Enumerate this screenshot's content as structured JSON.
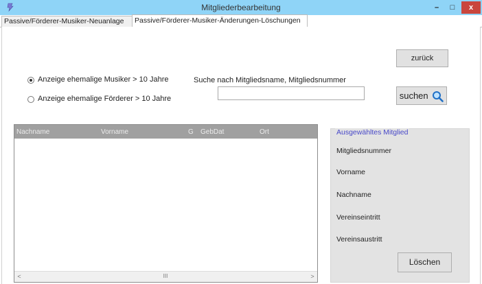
{
  "window": {
    "title": "Mitgliederbearbeitung",
    "minimize": "–",
    "maximize": "□",
    "close": "x"
  },
  "tabs": [
    {
      "label": "Passive/Förderer-Musiker-Neuanlage",
      "active": false
    },
    {
      "label": "Passive/Förderer-Musiker-Änderungen-Löschungen",
      "active": true
    }
  ],
  "buttons": {
    "back": "zurück",
    "search": "suchen",
    "delete": "Löschen"
  },
  "radios": [
    {
      "label": "Anzeige ehemalige Musiker > 10 Jahre",
      "checked": true
    },
    {
      "label": "Anzeige ehemalige Förderer > 10 Jahre",
      "checked": false
    }
  ],
  "search": {
    "label": "Suche nach Mitgliedsname, Mitgliedsnummer",
    "value": ""
  },
  "list": {
    "columns": [
      "Nachname",
      "Vorname",
      "G",
      "GebDat",
      "Ort"
    ],
    "rows": []
  },
  "selected_member": {
    "title": "Ausgewähltes Mitglied",
    "fields": [
      "Mitgliedsnummer",
      "Vorname",
      "Nachname",
      "Vereinseintritt",
      "Vereinsaustritt"
    ]
  },
  "scrollbar": {
    "left_arrow": "<",
    "right_arrow": ">",
    "thumb_grip": "III"
  },
  "colors": {
    "titlebar": "#8fd4f7",
    "close_button": "#c9463d",
    "group_title": "#4848c8",
    "list_header": "#a0a0a0"
  },
  "icons": [
    "app-icon",
    "magnifier-icon"
  ]
}
